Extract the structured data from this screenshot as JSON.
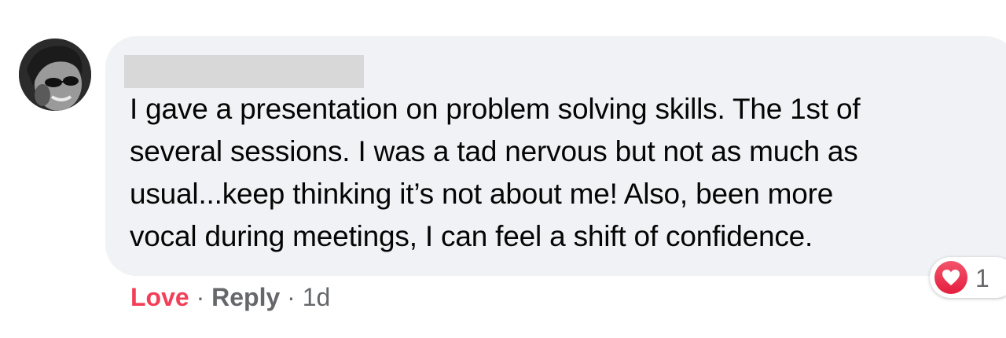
{
  "comment": {
    "text": "I gave a presentation on problem solving skills. The 1st of\nseveral sessions. I was a tad nervous but not as much as\nusual...keep thinking it’s not about me! Also, been more\nvocal during meetings, I can feel a shift of confidence.",
    "avatar_icon": "user-avatar-photo"
  },
  "actions": {
    "love_label": "Love",
    "separator": "·",
    "reply_label": "Reply",
    "time": "1d"
  },
  "reactions": {
    "icon": "heart-icon",
    "count": "1",
    "color": "#f33e58"
  }
}
